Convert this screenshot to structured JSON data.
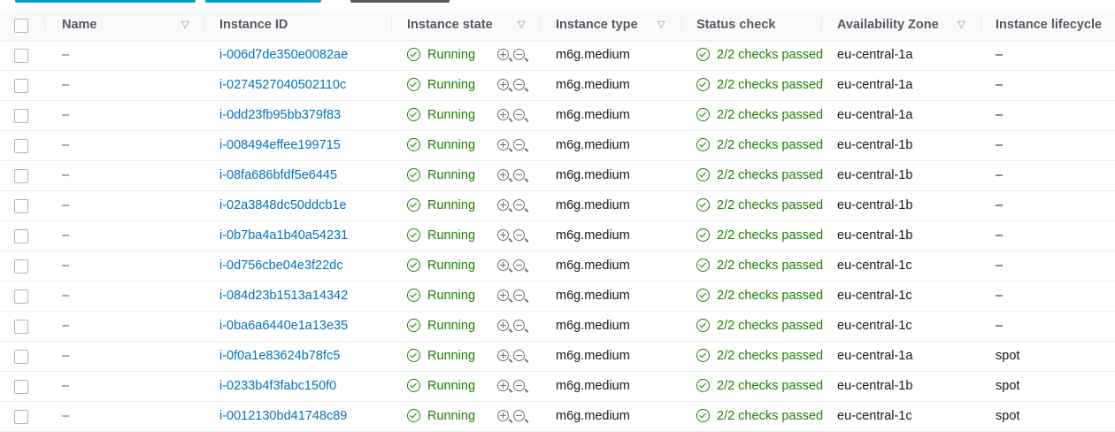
{
  "colors": {
    "link": "#0073bb",
    "success": "#1d8102",
    "header_text": "#545b64"
  },
  "columns": [
    "Name",
    "Instance ID",
    "Instance state",
    "Instance type",
    "Status check",
    "Availability Zone",
    "Instance lifecycle"
  ],
  "rows": [
    {
      "name": "–",
      "id": "i-006d7de350e0082ae",
      "state": "Running",
      "type": "m6g.medium",
      "status": "2/2 checks passed",
      "az": "eu-central-1a",
      "lifecycle": "–"
    },
    {
      "name": "–",
      "id": "i-027452704050211 0c",
      "state": "Running",
      "type": "m6g.medium",
      "status": "2/2 checks passed",
      "az": "eu-central-1a",
      "lifecycle": "–"
    },
    {
      "name": "–",
      "id": "i-0dd23fb95bb379f83",
      "state": "Running",
      "type": "m6g.medium",
      "status": "2/2 checks passed",
      "az": "eu-central-1a",
      "lifecycle": "–"
    },
    {
      "name": "–",
      "id": "i-008494effee199715",
      "state": "Running",
      "type": "m6g.medium",
      "status": "2/2 checks passed",
      "az": "eu-central-1b",
      "lifecycle": "–"
    },
    {
      "name": "–",
      "id": "i-08fa686bfdf5e6445",
      "state": "Running",
      "type": "m6g.medium",
      "status": "2/2 checks passed",
      "az": "eu-central-1b",
      "lifecycle": "–"
    },
    {
      "name": "–",
      "id": "i-02a3848dc50ddcb1e",
      "state": "Running",
      "type": "m6g.medium",
      "status": "2/2 checks passed",
      "az": "eu-central-1b",
      "lifecycle": "–"
    },
    {
      "name": "–",
      "id": "i-0b7ba4a1b40a54231",
      "state": "Running",
      "type": "m6g.medium",
      "status": "2/2 checks passed",
      "az": "eu-central-1b",
      "lifecycle": "–"
    },
    {
      "name": "–",
      "id": "i-0d756cbe04e3f22dc",
      "state": "Running",
      "type": "m6g.medium",
      "status": "2/2 checks passed",
      "az": "eu-central-1c",
      "lifecycle": "–"
    },
    {
      "name": "–",
      "id": "i-084d23b1513a14342",
      "state": "Running",
      "type": "m6g.medium",
      "status": "2/2 checks passed",
      "az": "eu-central-1c",
      "lifecycle": "–"
    },
    {
      "name": "–",
      "id": "i-0ba6a6440e1a13e35",
      "state": "Running",
      "type": "m6g.medium",
      "status": "2/2 checks passed",
      "az": "eu-central-1c",
      "lifecycle": "–"
    },
    {
      "name": "–",
      "id": "i-0f0a1e83624b78fc5",
      "state": "Running",
      "type": "m6g.medium",
      "status": "2/2 checks passed",
      "az": "eu-central-1a",
      "lifecycle": "spot"
    },
    {
      "name": "–",
      "id": "i-0233b4f3fabc150f0",
      "state": "Running",
      "type": "m6g.medium",
      "status": "2/2 checks passed",
      "az": "eu-central-1b",
      "lifecycle": "spot"
    },
    {
      "name": "–",
      "id": "i-0012130bd41748c89",
      "state": "Running",
      "type": "m6g.medium",
      "status": "2/2 checks passed",
      "az": "eu-central-1c",
      "lifecycle": "spot"
    }
  ]
}
